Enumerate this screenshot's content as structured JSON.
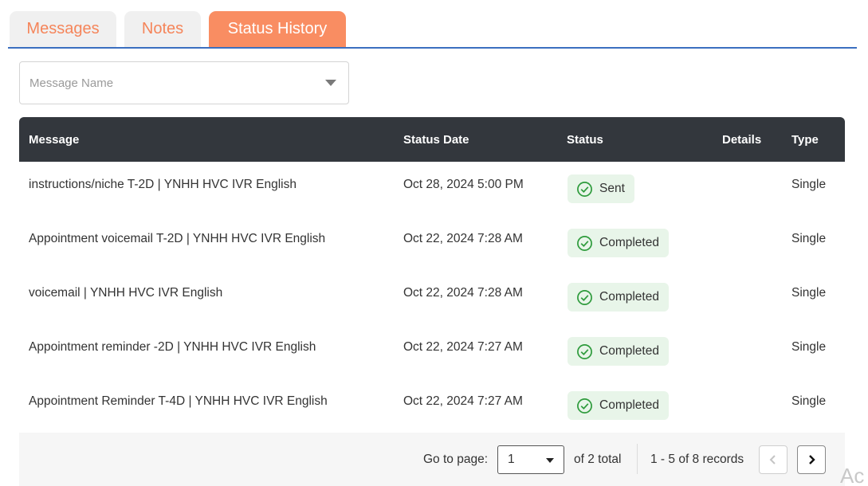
{
  "tabs": [
    {
      "label": "Messages",
      "active": false
    },
    {
      "label": "Notes",
      "active": false
    },
    {
      "label": "Status History",
      "active": true
    }
  ],
  "filter": {
    "placeholder": "Message Name"
  },
  "table": {
    "headers": {
      "message": "Message",
      "status_date": "Status Date",
      "status": "Status",
      "details": "Details",
      "type": "Type"
    },
    "rows": [
      {
        "message": "instructions/niche T-2D | YNHH HVC IVR English",
        "status_date": "Oct 28, 2024 5:00 PM",
        "status": "Sent",
        "details": "",
        "type": "Single"
      },
      {
        "message": "Appointment voicemail T-2D | YNHH HVC IVR English",
        "status_date": "Oct 22, 2024 7:28 AM",
        "status": "Completed",
        "details": "",
        "type": "Single"
      },
      {
        "message": "voicemail | YNHH HVC IVR English",
        "status_date": "Oct 22, 2024 7:28 AM",
        "status": "Completed",
        "details": "",
        "type": "Single"
      },
      {
        "message": "Appointment reminder -2D | YNHH HVC IVR English",
        "status_date": "Oct 22, 2024 7:27 AM",
        "status": "Completed",
        "details": "",
        "type": "Single"
      },
      {
        "message": "Appointment Reminder T-4D | YNHH HVC IVR English",
        "status_date": "Oct 22, 2024 7:27 AM",
        "status": "Completed",
        "details": "",
        "type": "Single"
      }
    ]
  },
  "pagination": {
    "go_to_label": "Go to page:",
    "current_page": "1",
    "of_total": "of 2 total",
    "records": "1 - 5 of 8 records"
  },
  "watermark": "Ac",
  "colors": {
    "tab_accent": "#f98d62",
    "header_bg": "#33373d",
    "status_green": "#2e9b3c",
    "badge_bg": "#e8f5e9",
    "divider_blue": "#3b6fc0"
  },
  "icons": {
    "status": "check-circle-icon",
    "dropdown": "chevron-down-icon",
    "prev": "chevron-left-icon",
    "next": "chevron-right-icon"
  }
}
